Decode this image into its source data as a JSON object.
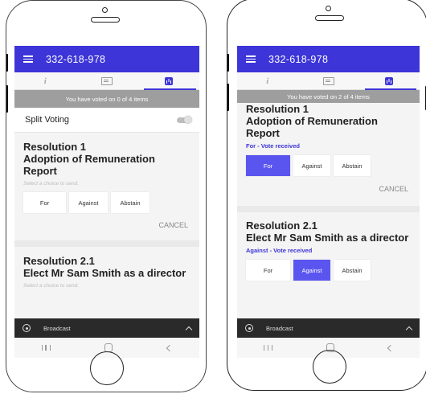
{
  "phones": [
    {
      "app_title": "332-618-978",
      "vote_summary": "You have voted on 0 of 4 items",
      "split_voting_label": "Split Voting",
      "resolutions": [
        {
          "number": "Resolution 1",
          "name": "Adoption of Remuneration Report",
          "hint": "Select a choice to send.",
          "choices": [
            "For",
            "Against",
            "Abstain"
          ],
          "cancel": "CANCEL"
        },
        {
          "number": "Resolution 2.1",
          "name": "Elect Mr Sam Smith as a director",
          "hint": "Select a choice to send."
        }
      ],
      "broadcast_label": "Broadcast"
    },
    {
      "app_title": "332-618-978",
      "vote_summary": "You have voted on 2 of 4 items",
      "resolutions": [
        {
          "number": "Resolution 1",
          "name": "Adoption of Remuneration Report",
          "status": "For - Vote received",
          "choices": [
            "For",
            "Against",
            "Abstain"
          ],
          "selected": "For",
          "cancel": "CANCEL"
        },
        {
          "number": "Resolution 2.1",
          "name": "Elect Mr Sam Smith as a director",
          "status": "Against - Vote received",
          "choices": [
            "For",
            "Against",
            "Abstain"
          ],
          "selected": "Against"
        }
      ],
      "broadcast_label": "Broadcast"
    }
  ],
  "colors": {
    "accent": "#3d35d8",
    "selected_choice": "#5b55f0",
    "vote_bar": "#9e9e9e"
  }
}
